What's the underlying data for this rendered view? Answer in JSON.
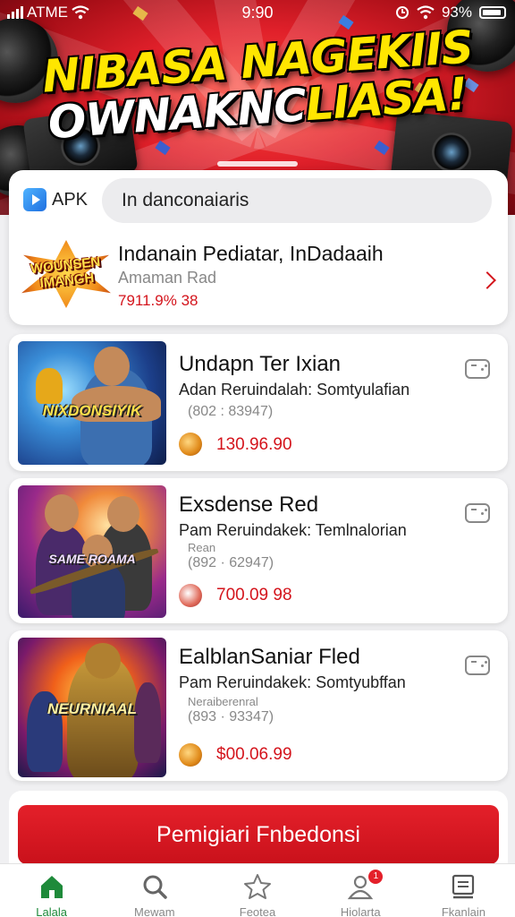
{
  "status_bar": {
    "carrier": "ATME",
    "time": "9:90",
    "battery": "93%"
  },
  "hero": {
    "line1": "NIBASA NAGEKIIS",
    "line2_main": "OWNAKNC",
    "line2_accent": "LIASA!"
  },
  "top_card": {
    "apk_label": "APK",
    "search_value": "In danconaiaris",
    "featured": {
      "logo_text_1": "WOUNSEN",
      "logo_text_2": "IMANGH",
      "title": "Indanain Pediatar, InDadaaih",
      "subtitle": "Amaman Rad",
      "price": "7911.9% 38"
    }
  },
  "games": [
    {
      "caption": "NIXDONSIYIK",
      "title": "Undapn Ter Ixian",
      "description": "Adan Reruindalah: Somtyulafian",
      "extra": "",
      "meta": "(802 : 83947)",
      "price": "130.96.90"
    },
    {
      "caption": "SAME ROAMA",
      "title": "Exsdense Red",
      "description": "Pam Reruindakek: Temlnalorian",
      "extra": "Rean",
      "meta": "(892 · 62947)",
      "price": "700.09 98"
    },
    {
      "caption": "NEURNIAAL",
      "title": "EalblanSaniar Fled",
      "description": "Pam Reruindakek: Somtyubffan",
      "extra": "Neraiberenral",
      "meta": "(893 · 93347)",
      "price": "$00.06.99"
    }
  ],
  "cta": {
    "label": "Pemigiari Fnbedonsi"
  },
  "tabs": [
    {
      "label": "Lalala",
      "icon": "home-icon",
      "active": true
    },
    {
      "label": "Mewam",
      "icon": "search-icon",
      "active": false
    },
    {
      "label": "Feotea",
      "icon": "star-icon",
      "active": false
    },
    {
      "label": "Hiolarta",
      "icon": "profile-icon",
      "active": false,
      "badge": "1"
    },
    {
      "label": "Fkanlain",
      "icon": "list-icon",
      "active": false
    }
  ],
  "colors": {
    "accent_red": "#d4141c",
    "cta_red": "#e4202a",
    "active_tab_green": "#1e8a3a"
  }
}
